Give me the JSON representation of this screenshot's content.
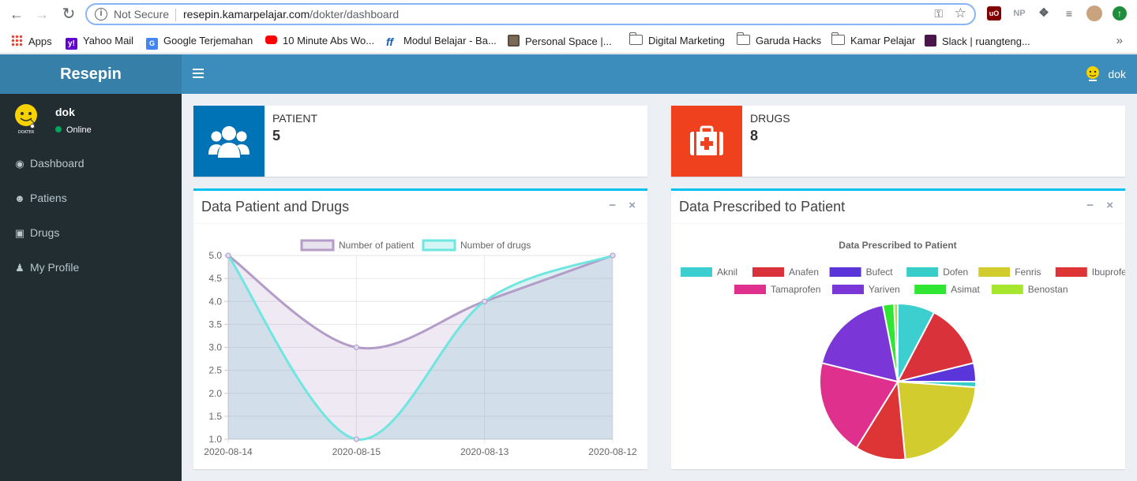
{
  "browser": {
    "security_label": "Not Secure",
    "url_host": "resepin.kamarpelajar.com",
    "url_path": "/dokter/dashboard",
    "bookmarks": [
      {
        "label": "Apps",
        "icon": "apps-grid-icon"
      },
      {
        "label": "Yahoo Mail",
        "icon": "yahoo-icon"
      },
      {
        "label": "Google Terjemahan",
        "icon": "google-translate-icon"
      },
      {
        "label": "10 Minute Abs Wo...",
        "icon": "youtube-icon"
      },
      {
        "label": "Modul Belajar - Ba...",
        "icon": "modul-icon"
      },
      {
        "label": "Personal Space |...",
        "icon": "personal-space-icon"
      },
      {
        "label": "Digital Marketing",
        "icon": "folder-icon"
      },
      {
        "label": "Garuda Hacks",
        "icon": "folder-icon"
      },
      {
        "label": "Kamar Pelajar",
        "icon": "folder-icon"
      },
      {
        "label": "Slack | ruangteng...",
        "icon": "slack-icon"
      }
    ],
    "more_label": "»"
  },
  "app": {
    "logo": "Resepin",
    "header_user": "dok",
    "sidebar": {
      "user_name": "dok",
      "status": "Online",
      "items": [
        {
          "label": "Dashboard",
          "icon": "dashboard-icon"
        },
        {
          "label": "Patiens",
          "icon": "users-icon"
        },
        {
          "label": "Drugs",
          "icon": "medkit-icon"
        },
        {
          "label": "My Profile",
          "icon": "user-icon"
        }
      ]
    },
    "cards": {
      "patient": {
        "label": "PATIENT",
        "value": "5",
        "color": "#0073b7"
      },
      "drugs": {
        "label": "DRUGS",
        "value": "8",
        "color": "#f0411e"
      }
    },
    "panels": {
      "line_title": "Data Patient and Drugs",
      "pie_title": "Data Prescribed to Patient",
      "collapse_label": "−",
      "close_label": "×"
    }
  },
  "chart_data": [
    {
      "type": "line",
      "title": "",
      "categories": [
        "2020-08-14",
        "2020-08-15",
        "2020-08-13",
        "2020-08-12"
      ],
      "ylim": [
        1.0,
        5.0
      ],
      "yticks": [
        "1.0",
        "1.5",
        "2.0",
        "2.5",
        "3.0",
        "3.5",
        "4.0",
        "4.5",
        "5.0"
      ],
      "legend": "top",
      "grid": true,
      "series": [
        {
          "name": "Number of patient",
          "values": [
            5,
            3,
            4,
            5
          ],
          "color": "#b39cc8"
        },
        {
          "name": "Number of drugs",
          "values": [
            5,
            1,
            4,
            5
          ],
          "color": "#6fe6e0"
        }
      ]
    },
    {
      "type": "pie",
      "title": "Data Prescribed to Patient",
      "legend": "top",
      "labels": [
        "Aknil",
        "Anafen",
        "Bufect",
        "Dofen",
        "Fenris",
        "Ibuprofen",
        "Tamaprofen",
        "Yariven",
        "Asimat",
        "Benostan"
      ],
      "values": [
        2,
        3.5,
        1,
        0.3,
        5.8,
        2.7,
        5.2,
        4.7,
        0.6,
        0.2
      ],
      "colors": [
        "#3dcfcf",
        "#d9323a",
        "#5a35d9",
        "#37cdc8",
        "#d3cc2e",
        "#dd3535",
        "#e0308e",
        "#7a36d6",
        "#2fe632",
        "#a6e62f"
      ]
    }
  ]
}
